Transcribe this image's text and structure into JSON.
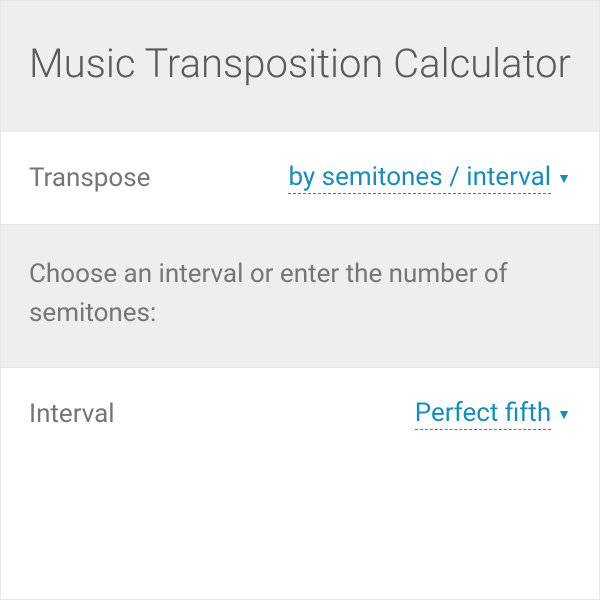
{
  "header": {
    "title": "Music Transposition Calculator"
  },
  "rows": {
    "transpose": {
      "label": "Transpose",
      "value": "by semitones / interval"
    },
    "instruction": "Choose an interval or enter the number of semitones:",
    "interval": {
      "label": "Interval",
      "value": "Perfect fifth"
    }
  }
}
